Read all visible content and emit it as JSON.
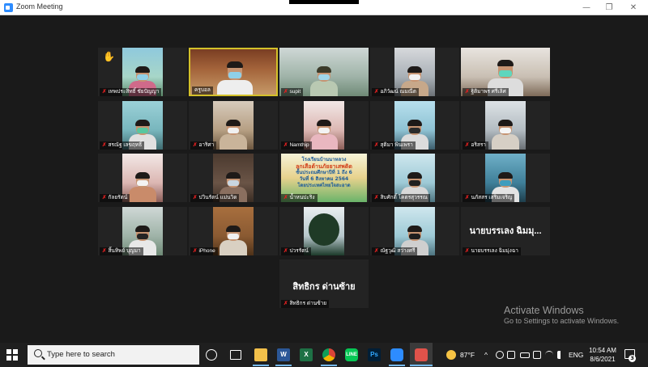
{
  "window": {
    "title": "Zoom Meeting",
    "minimize": "—",
    "restore": "❐",
    "close": "✕"
  },
  "participants": [
    {
      "name": "เทพประสิทธิ์ ชัยปัญญา",
      "raised_hand": true
    },
    {
      "name": "ครูบอล",
      "active_speaker": true
    },
    {
      "name": "supit"
    },
    {
      "name": "อภิวัฒน์ ณมณีต"
    },
    {
      "name": "ฐิติมาพร ศรีเลิศ"
    },
    {
      "name": "สรณัฐ เลขฤทธิ์"
    },
    {
      "name": "อาริศา"
    },
    {
      "name": "Namthip"
    },
    {
      "name": "สุติมา พินเพรา"
    },
    {
      "name": "อริสรา"
    },
    {
      "name": "กัลยรัตน์"
    },
    {
      "name": "ปวินรัตน์ แม่นวิด"
    },
    {
      "name": "น้ำหนปะริง"
    },
    {
      "name": "สิบศักดิ์ โคตรสุวรรณ"
    },
    {
      "name": "นภัสสร เสริมเจริญ"
    },
    {
      "name": "สิ้นทิพย์ บุญมา"
    },
    {
      "name": "iPhone"
    },
    {
      "name": "ปวรรัตน์"
    },
    {
      "name": "ณัฐวุฒิ สว่างศรี"
    },
    {
      "name": "นายบรรเลง ฉิมมุ่งฉา",
      "display_text": "นายบรรเลง ฉิมมุ..."
    },
    {
      "name": "สิทธิกร ด่านซ้าย",
      "display_text": "สิทธิกร ด่านซ้าย"
    }
  ],
  "poster": {
    "line1": "โรงเรียนบ้านนาหลวง",
    "line2": "ลูกเสือต้านภัยยาเสพติด",
    "line3": "ชั้นประถมศึกษาปีที่ 1 ถึง 6",
    "line4": "วันที่ 6 สิงหาคม 2564",
    "line5": "โดยประเทศไทยใจสะอาด"
  },
  "watermark": {
    "line1": "Activate Windows",
    "line2": "Go to Settings to activate Windows."
  },
  "taskbar": {
    "search_placeholder": "Type here to search",
    "weather": "87°F",
    "language": "ENG",
    "time": "10:54 AM",
    "date": "8/6/2021",
    "notifications": "3",
    "tray_arrow": "^"
  },
  "colors": {
    "zoom_blue": "#2d8cff",
    "active_speaker_border": "#d4c12a",
    "muted_mic": "#e02020",
    "taskbar": "#1f1f1f"
  }
}
